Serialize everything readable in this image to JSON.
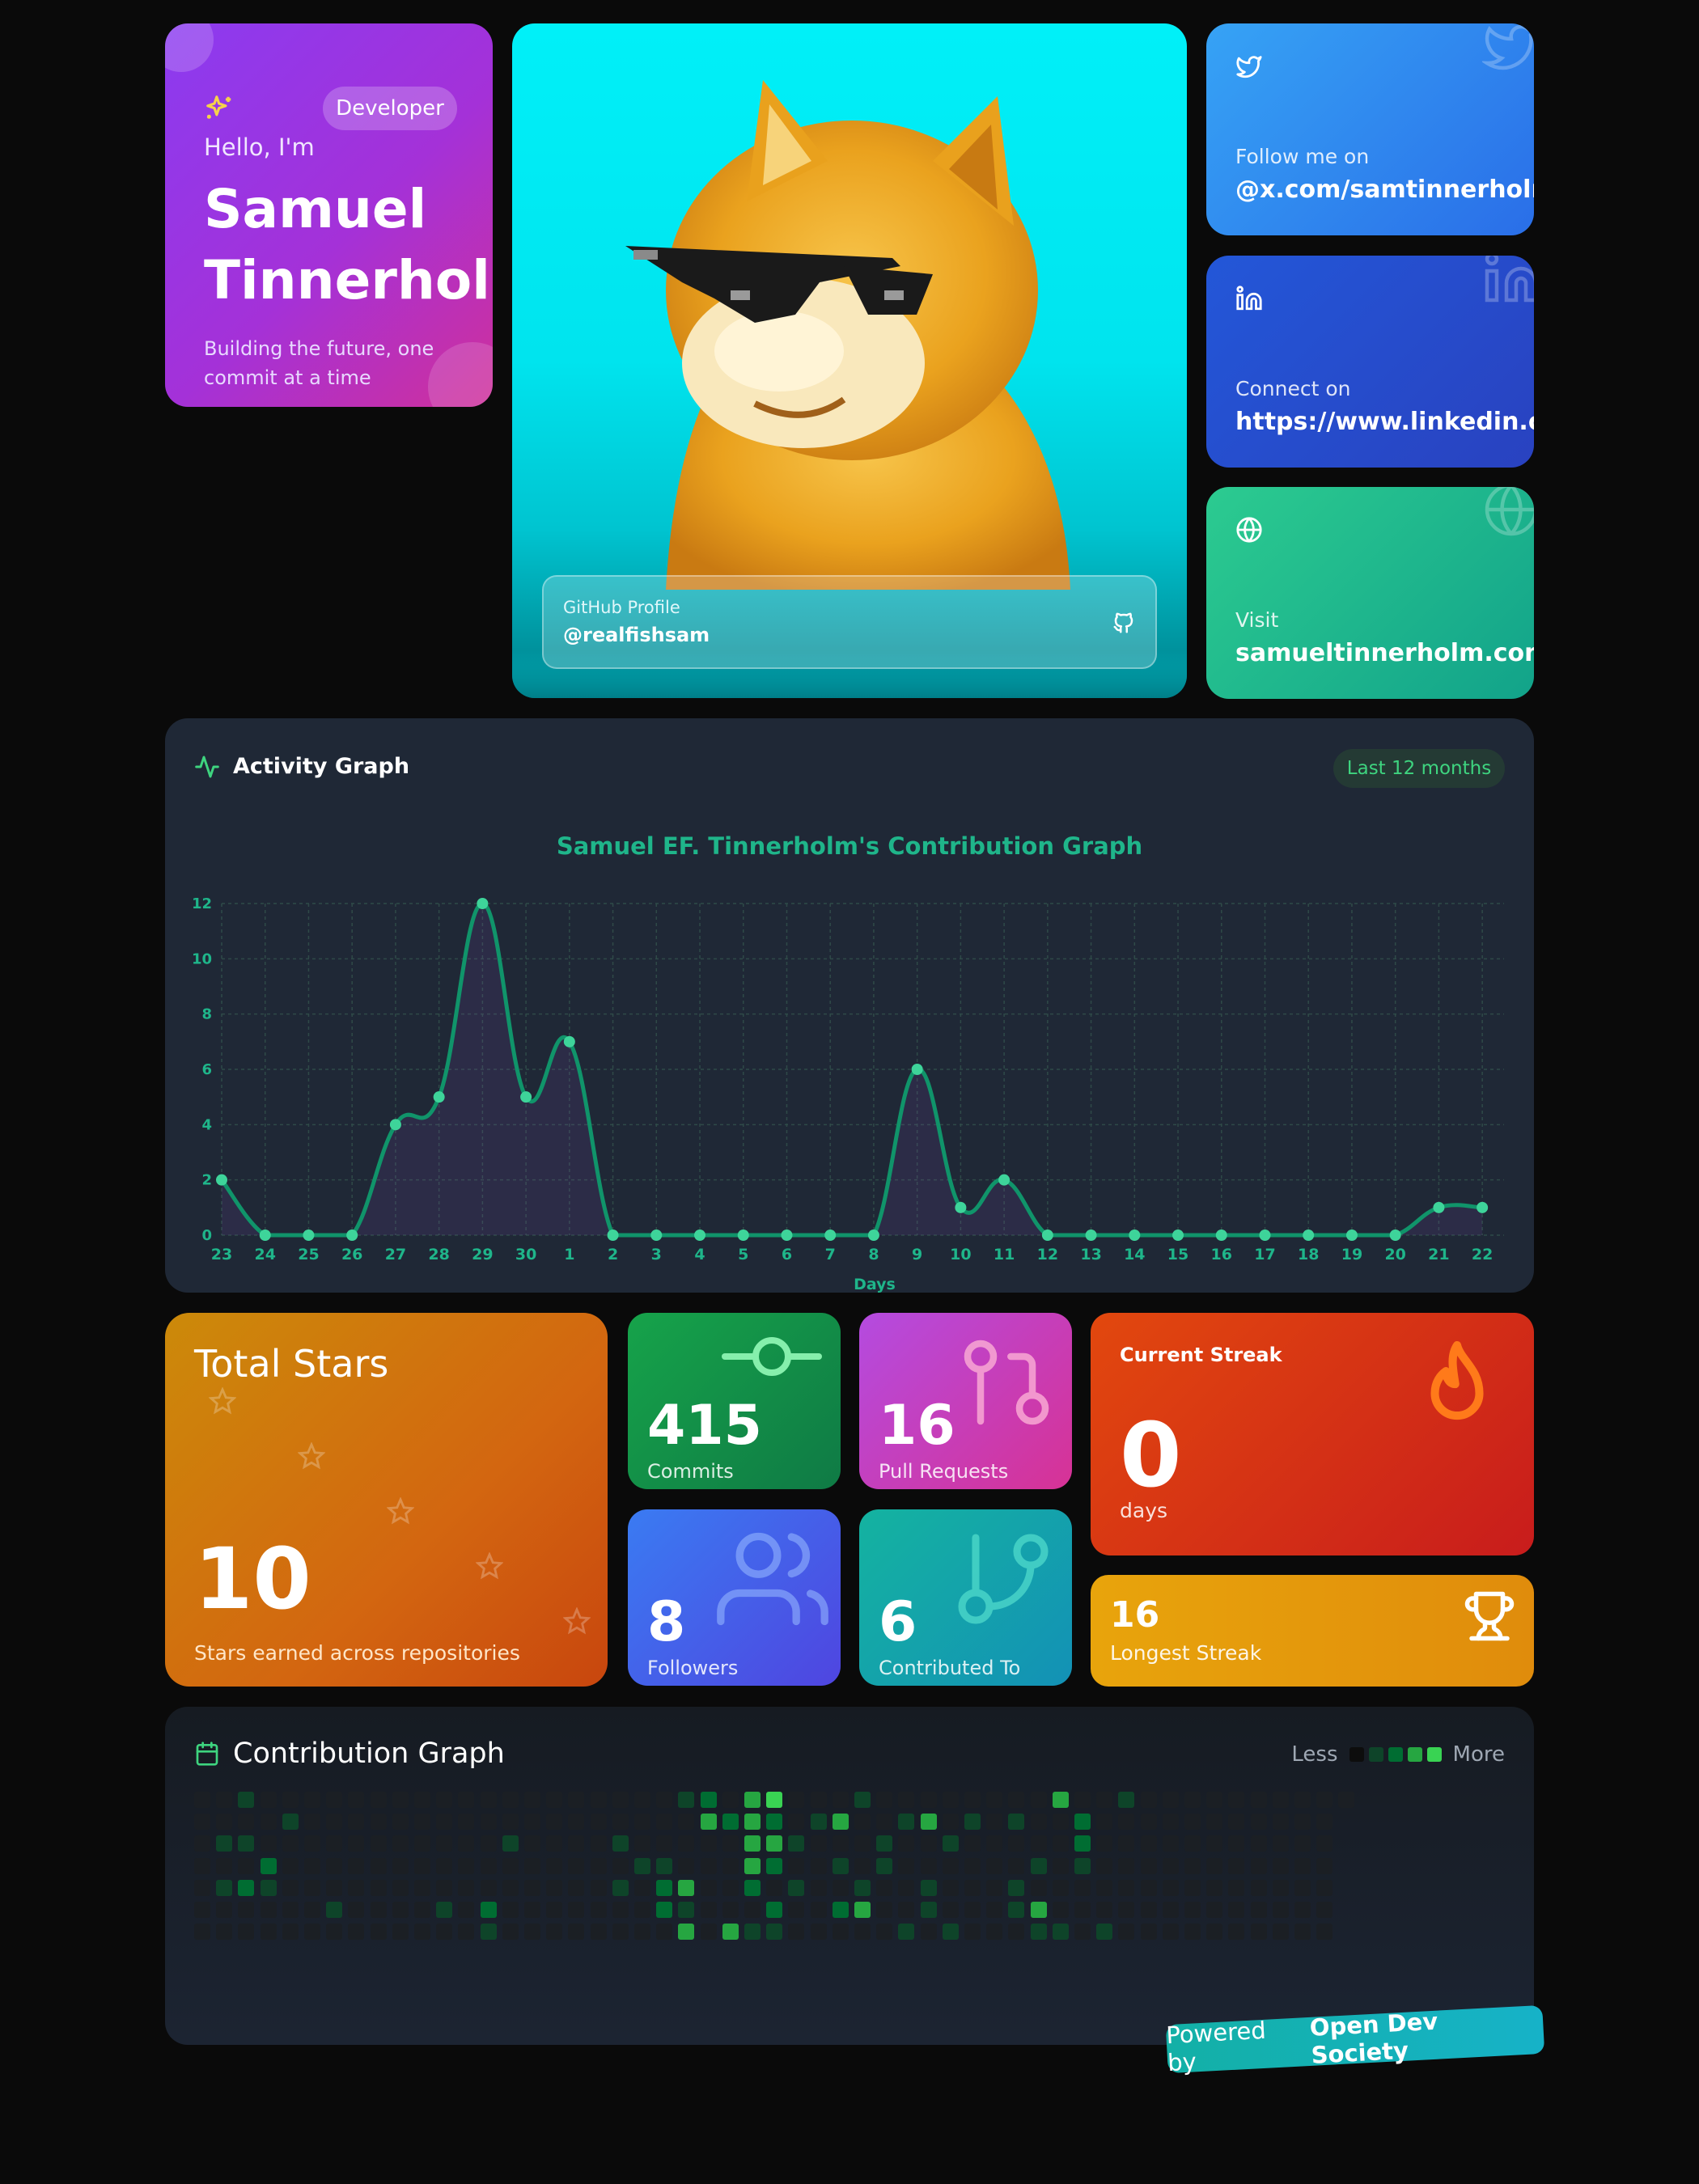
{
  "intro": {
    "badge": "Developer",
    "greeting": "Hello, I'm",
    "name": "Samuel\nTinnerholm",
    "tagline": "Building the future, one commit at a time"
  },
  "github": {
    "label": "GitHub Profile",
    "handle": "@realfishsam"
  },
  "social": {
    "twitter": {
      "label": "Follow me on",
      "value": "@x.com/samtinnerholm"
    },
    "linkedin": {
      "label": "Connect on",
      "value": "https://www.linkedin.com"
    },
    "website": {
      "label": "Visit",
      "value": "samueltinnerholm.com"
    }
  },
  "activity": {
    "header": "Activity Graph",
    "range_pill": "Last 12 months"
  },
  "chart_data": {
    "type": "line",
    "title": "Samuel EF. Tinnerholm's Contribution Graph",
    "xlabel": "Days",
    "ylabel": "",
    "categories": [
      "23",
      "24",
      "25",
      "26",
      "27",
      "28",
      "29",
      "30",
      "1",
      "2",
      "3",
      "4",
      "5",
      "6",
      "7",
      "8",
      "9",
      "10",
      "11",
      "12",
      "13",
      "14",
      "15",
      "16",
      "17",
      "18",
      "19",
      "20",
      "21",
      "22"
    ],
    "values": [
      2,
      0,
      0,
      0,
      4,
      5,
      12,
      5,
      7,
      0,
      0,
      0,
      0,
      0,
      0,
      0,
      6,
      1,
      2,
      0,
      0,
      0,
      0,
      0,
      0,
      0,
      0,
      0,
      1,
      1
    ],
    "y_ticks": [
      0,
      2,
      4,
      6,
      8,
      10,
      12
    ],
    "ylim": [
      0,
      12
    ],
    "grid": true,
    "line_color": "#10946a",
    "point_color": "#3ed49a",
    "label_color": "#1fb58a"
  },
  "stats": {
    "stars": {
      "title": "Total Stars",
      "value": "10",
      "subtitle": "Stars earned across repositories"
    },
    "commits": {
      "value": "415",
      "label": "Commits"
    },
    "pull_requests": {
      "value": "16",
      "label": "Pull Requests"
    },
    "followers": {
      "value": "8",
      "label": "Followers"
    },
    "contributed_to": {
      "value": "6",
      "label": "Contributed To"
    },
    "current_streak": {
      "label": "Current Streak",
      "value": "0",
      "unit": "days"
    },
    "longest_streak": {
      "value": "16",
      "label": "Longest Streak"
    }
  },
  "contribution_graph": {
    "title": "Contribution Graph",
    "legend_less": "Less",
    "legend_more": "More",
    "legend_colors": [
      "#161b22",
      "#0e4429",
      "#006d32",
      "#26a641",
      "#39d353"
    ],
    "columns": 53,
    "rows": 7,
    "cells": [
      [
        22,
        0,
        1
      ],
      [
        2,
        0,
        1
      ],
      [
        23,
        0,
        2
      ],
      [
        23,
        1,
        3
      ],
      [
        24,
        1,
        2
      ],
      [
        25,
        0,
        3
      ],
      [
        25,
        1,
        3
      ],
      [
        25,
        2,
        3
      ],
      [
        25,
        3,
        3
      ],
      [
        25,
        4,
        2
      ],
      [
        26,
        0,
        4
      ],
      [
        26,
        1,
        2
      ],
      [
        26,
        2,
        3
      ],
      [
        26,
        3,
        2
      ],
      [
        26,
        5,
        2
      ],
      [
        27,
        2,
        1
      ],
      [
        27,
        4,
        1
      ],
      [
        29,
        1,
        3
      ],
      [
        29,
        3,
        1
      ],
      [
        29,
        5,
        2
      ],
      [
        30,
        0,
        1
      ],
      [
        30,
        4,
        1
      ],
      [
        30,
        5,
        3
      ],
      [
        31,
        2,
        1
      ],
      [
        31,
        3,
        1
      ],
      [
        33,
        1,
        3
      ],
      [
        33,
        4,
        1
      ],
      [
        33,
        5,
        1
      ],
      [
        34,
        6,
        1
      ],
      [
        35,
        1,
        1
      ],
      [
        37,
        1,
        1
      ],
      [
        37,
        4,
        1
      ],
      [
        37,
        5,
        1
      ],
      [
        38,
        3,
        1
      ],
      [
        38,
        5,
        3
      ],
      [
        38,
        6,
        1
      ],
      [
        39,
        0,
        3
      ],
      [
        39,
        6,
        1
      ],
      [
        40,
        1,
        2
      ],
      [
        40,
        2,
        2
      ],
      [
        40,
        3,
        1
      ],
      [
        41,
        6,
        1
      ],
      [
        42,
        0,
        1
      ],
      [
        2,
        2,
        1
      ],
      [
        2,
        4,
        2
      ],
      [
        3,
        3,
        2
      ],
      [
        3,
        4,
        1
      ],
      [
        4,
        1,
        1
      ],
      [
        11,
        5,
        1
      ],
      [
        13,
        5,
        2
      ],
      [
        13,
        6,
        1
      ],
      [
        14,
        2,
        1
      ],
      [
        21,
        3,
        1
      ],
      [
        21,
        4,
        2
      ],
      [
        22,
        4,
        3
      ],
      [
        22,
        6,
        3
      ],
      [
        24,
        6,
        3
      ],
      [
        25,
        6,
        1
      ],
      [
        26,
        6,
        1
      ],
      [
        19,
        2,
        1
      ],
      [
        19,
        4,
        1
      ],
      [
        20,
        3,
        1
      ],
      [
        21,
        5,
        2
      ],
      [
        22,
        5,
        1
      ],
      [
        28,
        1,
        1
      ],
      [
        32,
        1,
        1
      ],
      [
        32,
        6,
        1
      ],
      [
        34,
        2,
        1
      ],
      [
        1,
        4,
        1
      ],
      [
        1,
        2,
        1
      ],
      [
        6,
        5,
        1
      ]
    ]
  },
  "footer": {
    "powered_by": "Powered by",
    "org": "Open Dev Society"
  }
}
